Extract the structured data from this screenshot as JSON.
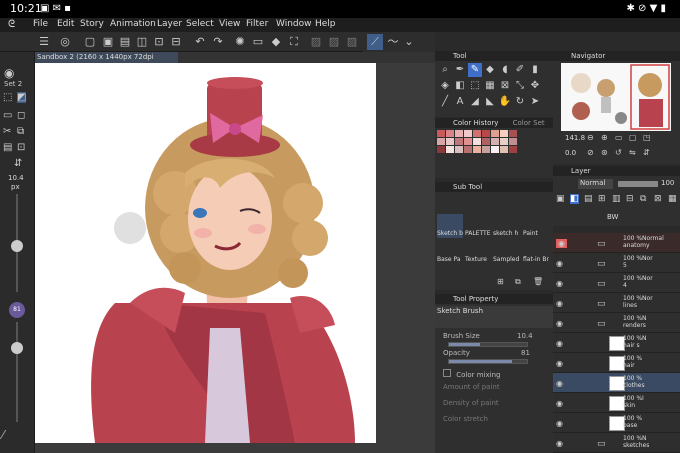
{
  "status": {
    "time": "10:21",
    "icons": "▣ ✉ ▪",
    "right_icons": "✱ ⊘ ▼ ▮"
  },
  "menu": [
    "File",
    "Edit",
    "Story",
    "Animation",
    "Layer",
    "Select",
    "View",
    "Filter",
    "Window",
    "Help"
  ],
  "tab": {
    "label": "Sandbox 2 (2160 x 1440px 72dpi 141.8%)",
    "close": "×"
  },
  "left": {
    "set_label": "Set 2",
    "brush_size": "10.4",
    "brush_unit": "px",
    "opacity": "81"
  },
  "tool_panel": {
    "title": "Tool"
  },
  "navigator": {
    "title": "Navigator",
    "zoom": "141.8",
    "angle": "0.0"
  },
  "color_history": {
    "title": "Color History",
    "tab2": "Color Set",
    "colors": [
      "#c85a5a",
      "#d98585",
      "#e8b0b0",
      "#f0c8c8",
      "#d07070",
      "#b84848",
      "#e0a090",
      "#f5d0c0",
      "#a85050",
      "#d8a8a8",
      "#eac8c8",
      "#c07878",
      "#e09090",
      "#f0e0e0",
      "#b06060",
      "#d4b0b0",
      "#e8d0c8",
      "#c09090",
      "#8a3a3a",
      "#f5e5e0",
      "#d8c0c0",
      "#b87070",
      "#eab0a0",
      "#c8a0a0",
      "#f8f0f0",
      "#e0c0b0",
      "#a04040"
    ]
  },
  "sub_tool": {
    "title": "Sub Tool",
    "row1": [
      "Sketch b",
      "PALETTE",
      "sketch h",
      "Paint"
    ],
    "row2": [
      "Base Pa",
      "Texture",
      "Sampled",
      "flat-in Br"
    ]
  },
  "tool_property": {
    "title": "Tool Property",
    "brush_name": "Sketch Brush",
    "brush_size_label": "Brush Size",
    "brush_size_value": "10.4",
    "opacity_label": "Opacity",
    "opacity_value": "81",
    "color_mixing": "Color mixing",
    "amount": "Amount of paint",
    "density": "Density of paint",
    "stretch": "Color stretch"
  },
  "layer_panel": {
    "title": "Layer",
    "blend": "Normal",
    "opacity": "100",
    "bw_label": "BW"
  },
  "layers": [
    {
      "label": "100 %Normal",
      "name": "anatomy",
      "type": "folder",
      "highlight": true
    },
    {
      "label": "100 %Nor",
      "name": "5",
      "type": "folder"
    },
    {
      "label": "100 %Nor",
      "name": "4",
      "type": "folder"
    },
    {
      "label": "100 %Nor",
      "name": "lines",
      "type": "folder"
    },
    {
      "label": "100 %N",
      "name": "renders",
      "type": "folder"
    },
    {
      "label": "100 %N",
      "name": "hair s",
      "type": "layer"
    },
    {
      "label": "100 %",
      "name": "hair",
      "type": "layer"
    },
    {
      "label": "100 %",
      "name": "clothes",
      "type": "layer",
      "selected": true
    },
    {
      "label": "100 %I",
      "name": "skin",
      "type": "layer"
    },
    {
      "label": "100 %",
      "name": "base",
      "type": "layer"
    },
    {
      "label": "100 %N",
      "name": "sketches",
      "type": "folder"
    }
  ]
}
